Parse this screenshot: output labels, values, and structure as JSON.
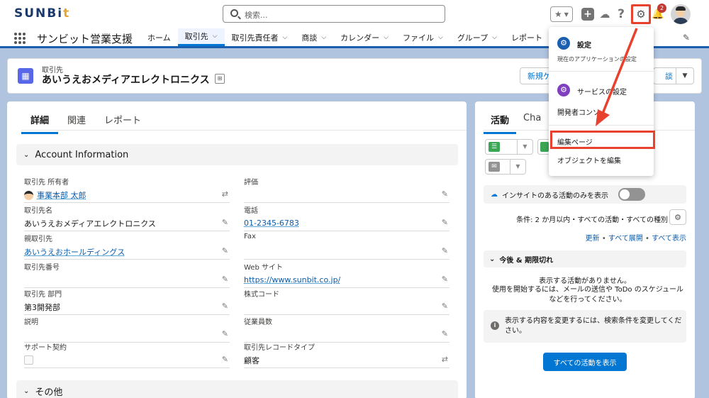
{
  "topbar": {
    "logo_main": "SUNBi",
    "logo_accent": "t",
    "search_placeholder": "検索...",
    "help": "?",
    "notification_count": "2"
  },
  "nav": {
    "app_name": "サンビット営業支援",
    "items": [
      {
        "label": "ホーム",
        "chevron": false,
        "active": false
      },
      {
        "label": "取引先",
        "chevron": true,
        "active": true
      },
      {
        "label": "取引先責任者",
        "chevron": true,
        "active": false
      },
      {
        "label": "商談",
        "chevron": true,
        "active": false
      },
      {
        "label": "カレンダー",
        "chevron": true,
        "active": false
      },
      {
        "label": "ファイル",
        "chevron": true,
        "active": false
      },
      {
        "label": "グループ",
        "chevron": true,
        "active": false
      },
      {
        "label": "レポート",
        "chevron": false,
        "active": false
      }
    ]
  },
  "record": {
    "type": "取引先",
    "name": "あいうえおメディアエレクトロニクス",
    "new_button": "新規ケ",
    "button2": "談"
  },
  "detail": {
    "tabs": [
      "詳細",
      "関連",
      "レポート"
    ],
    "section_title": "Account Information",
    "section_other": "その他",
    "left_fields": [
      {
        "label": "取引先 所有者",
        "value": "事業本部 太郎",
        "link": true
      },
      {
        "label": "取引先名",
        "value": "あいうえおメディアエレクトロニクス",
        "link": false
      },
      {
        "label": "親取引先",
        "value": "あいうえおホールディングス",
        "link": true
      },
      {
        "label": "取引先番号",
        "value": "",
        "link": false
      },
      {
        "label": "取引先 部門",
        "value": "第3開発部",
        "link": false
      },
      {
        "label": "説明",
        "value": "",
        "link": false
      },
      {
        "label": "サポート契約",
        "value": "",
        "link": false
      }
    ],
    "right_fields": [
      {
        "label": "評価",
        "value": "",
        "link": false
      },
      {
        "label": "電話",
        "value": "01-2345-6783",
        "link": true
      },
      {
        "label": "Fax",
        "value": "",
        "link": false
      },
      {
        "label": "Web サイト",
        "value": "https://www.sunbit.co.jp/",
        "link": true
      },
      {
        "label": "株式コード",
        "value": "",
        "link": false
      },
      {
        "label": "従業員数",
        "value": "",
        "link": false
      },
      {
        "label": "取引先レコードタイプ",
        "value": "顧客",
        "link": false
      }
    ]
  },
  "activity": {
    "tabs": [
      "活動",
      "Cha"
    ],
    "insight_label": "インサイトのある活動のみを表示",
    "filter": "条件: 2 か月以内・すべての活動・すべての種別",
    "links": [
      "更新",
      "すべて展開",
      "すべて表示"
    ],
    "upcoming": "今後 & 期限切れ",
    "empty_title": "表示する活動がありません。",
    "empty_body": "使用を開始するには、メールの送信や ToDo のスケジュールなどを行ってください。",
    "info": "表示する内容を変更するには、検索条件を変更してください。",
    "show_all": "すべての活動を表示"
  },
  "menu": {
    "setup": "設定",
    "setup_sub": "現在のアプリケーションの設定",
    "service_setup": "サービスの設定",
    "dev_console": "開発者コンソ",
    "edit_page": "編集ページ",
    "edit_object": "オブジェクトを編集"
  },
  "colors": {
    "brand": "#0176d3",
    "highlight": "#e8412e",
    "setup_icon": "#1b5fb0",
    "service_icon": "#7f3fbf"
  }
}
